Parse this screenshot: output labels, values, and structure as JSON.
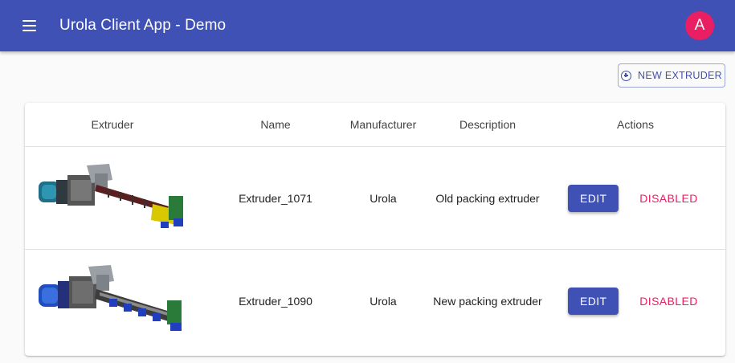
{
  "app": {
    "title": "Urola Client App - Demo",
    "avatar_letter": "A",
    "menu_icon": "hamburger-menu-icon"
  },
  "toolbar": {
    "new_extruder_label": "NEW EXTRUDER",
    "new_extruder_icon": "add-circle-outline-icon"
  },
  "table": {
    "columns": [
      "Extruder",
      "Name",
      "Manufacturer",
      "Description",
      "Actions"
    ],
    "rows": [
      {
        "name": "Extruder_1071",
        "manufacturer": "Urola",
        "description": "Old packing extruder",
        "edit_label": "EDIT",
        "disabled_label": "DISABLED"
      },
      {
        "name": "Extruder_1090",
        "manufacturer": "Urola",
        "description": "New packing extruder",
        "edit_label": "EDIT",
        "disabled_label": "DISABLED"
      }
    ]
  },
  "colors": {
    "primary": "#3f51b5",
    "secondary": "#e91e63",
    "background": "#fafafa"
  }
}
